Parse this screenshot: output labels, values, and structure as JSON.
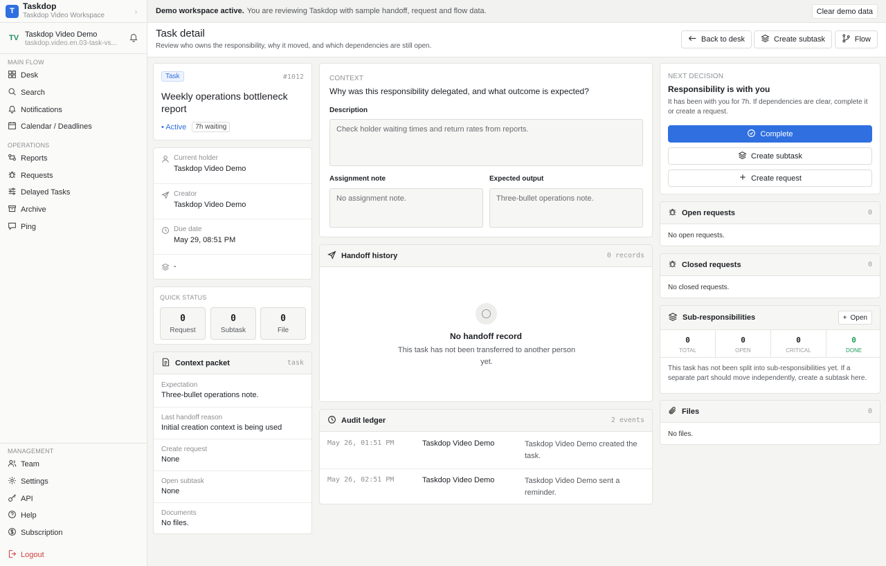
{
  "workspace": {
    "logo_letter": "T",
    "name": "Taskdop",
    "subtitle": "Taskdop Video Workspace"
  },
  "account": {
    "initials": "TV",
    "name": "Taskdop Video Demo",
    "email": "taskdop.video.en.03-task-vs..."
  },
  "nav": {
    "main_flow_label": "MAIN FLOW",
    "main_flow": [
      {
        "label": "Desk",
        "icon": "grid-icon"
      },
      {
        "label": "Search",
        "icon": "search-icon"
      },
      {
        "label": "Notifications",
        "icon": "bell-icon"
      },
      {
        "label": "Calendar / Deadlines",
        "icon": "calendar-icon"
      }
    ],
    "operations_label": "OPERATIONS",
    "operations": [
      {
        "label": "Reports",
        "icon": "reports-icon"
      },
      {
        "label": "Requests",
        "icon": "bug-icon"
      },
      {
        "label": "Delayed Tasks",
        "icon": "sliders-icon"
      },
      {
        "label": "Archive",
        "icon": "archive-icon"
      },
      {
        "label": "Ping",
        "icon": "ping-icon"
      }
    ],
    "management_label": "MANAGEMENT",
    "management": [
      {
        "label": "Team",
        "icon": "users-icon"
      },
      {
        "label": "Settings",
        "icon": "gear-icon"
      },
      {
        "label": "API",
        "icon": "key-icon"
      },
      {
        "label": "Help",
        "icon": "help-icon"
      },
      {
        "label": "Subscription",
        "icon": "dollar-icon"
      }
    ],
    "logout": "Logout"
  },
  "banner": {
    "bold": "Demo workspace active.",
    "message": "You are reviewing Taskdop with sample handoff, request and flow data.",
    "clear_button": "Clear demo data"
  },
  "header": {
    "title": "Task detail",
    "subtitle": "Review who owns the responsibility, why it moved, and which dependencies are still open.",
    "back_button": "Back to desk",
    "subtask_button": "Create subtask",
    "flow_button": "Flow"
  },
  "task": {
    "tag": "Task",
    "id": "#1012",
    "title": "Weekly operations bottleneck report",
    "status": "Active",
    "waiting": "7h waiting"
  },
  "meta": [
    {
      "label": "Current holder",
      "value": "Taskdop Video Demo",
      "icon": "user-icon"
    },
    {
      "label": "Creator",
      "value": "Taskdop Video Demo",
      "icon": "send-icon"
    },
    {
      "label": "Due date",
      "value": "May 29, 08:51 PM",
      "icon": "clock-icon"
    },
    {
      "label": "",
      "value": "-",
      "icon": "layers-icon"
    }
  ],
  "quick_status": {
    "label": "QUICK STATUS",
    "items": [
      {
        "count": "0",
        "label": "Request"
      },
      {
        "count": "0",
        "label": "Subtask"
      },
      {
        "count": "0",
        "label": "File"
      }
    ]
  },
  "context_packet": {
    "title": "Context packet",
    "tag": "task",
    "rows": [
      {
        "label": "Expectation",
        "value": "Three-bullet operations note."
      },
      {
        "label": "Last handoff reason",
        "value": "Initial creation context is being used"
      },
      {
        "label": "Create request",
        "value": "None"
      },
      {
        "label": "Open subtask",
        "value": "None"
      },
      {
        "label": "Documents",
        "value": "No files."
      }
    ]
  },
  "context": {
    "eyebrow": "CONTEXT",
    "question": "Why was this responsibility delegated, and what outcome is expected?",
    "description_label": "Description",
    "description_placeholder": "Check holder waiting times and return rates from reports.",
    "assignment_label": "Assignment note",
    "assignment_placeholder": "No assignment note.",
    "output_label": "Expected output",
    "output_placeholder": "Three-bullet operations note."
  },
  "handoff": {
    "title": "Handoff history",
    "count": "0 records",
    "empty_title": "No handoff record",
    "empty_text": "This task has not been transferred to another person yet."
  },
  "audit": {
    "title": "Audit ledger",
    "count": "2 events",
    "rows": [
      {
        "time": "May 26, 01:51 PM",
        "actor": "Taskdop Video Demo",
        "action": "Taskdop Video Demo created the task."
      },
      {
        "time": "May 26, 02:51 PM",
        "actor": "Taskdop Video Demo",
        "action": "Taskdop Video Demo sent a reminder."
      }
    ]
  },
  "decision": {
    "eyebrow": "NEXT DECISION",
    "title": "Responsibility is with you",
    "text": "It has been with you for 7h. If dependencies are clear, complete it or create a request.",
    "complete_button": "Complete",
    "subtask_button": "Create subtask",
    "request_button": "Create request"
  },
  "open_requests": {
    "title": "Open requests",
    "count": "0",
    "empty": "No open requests."
  },
  "closed_requests": {
    "title": "Closed requests",
    "count": "0",
    "empty": "No closed requests."
  },
  "subresp": {
    "title": "Sub-responsibilities",
    "open_button": "Open",
    "stats": [
      {
        "count": "0",
        "label": "TOTAL"
      },
      {
        "count": "0",
        "label": "OPEN"
      },
      {
        "count": "0",
        "label": "CRITICAL"
      },
      {
        "count": "0",
        "label": "DONE"
      }
    ],
    "text": "This task has not been split into sub-responsibilities yet. If a separate part should move independently, create a subtask here."
  },
  "files": {
    "title": "Files",
    "count": "0",
    "empty": "No files."
  },
  "colors": {
    "accent": "#2f6fe0",
    "done": "#1f9a5a",
    "logout": "#d04040"
  }
}
